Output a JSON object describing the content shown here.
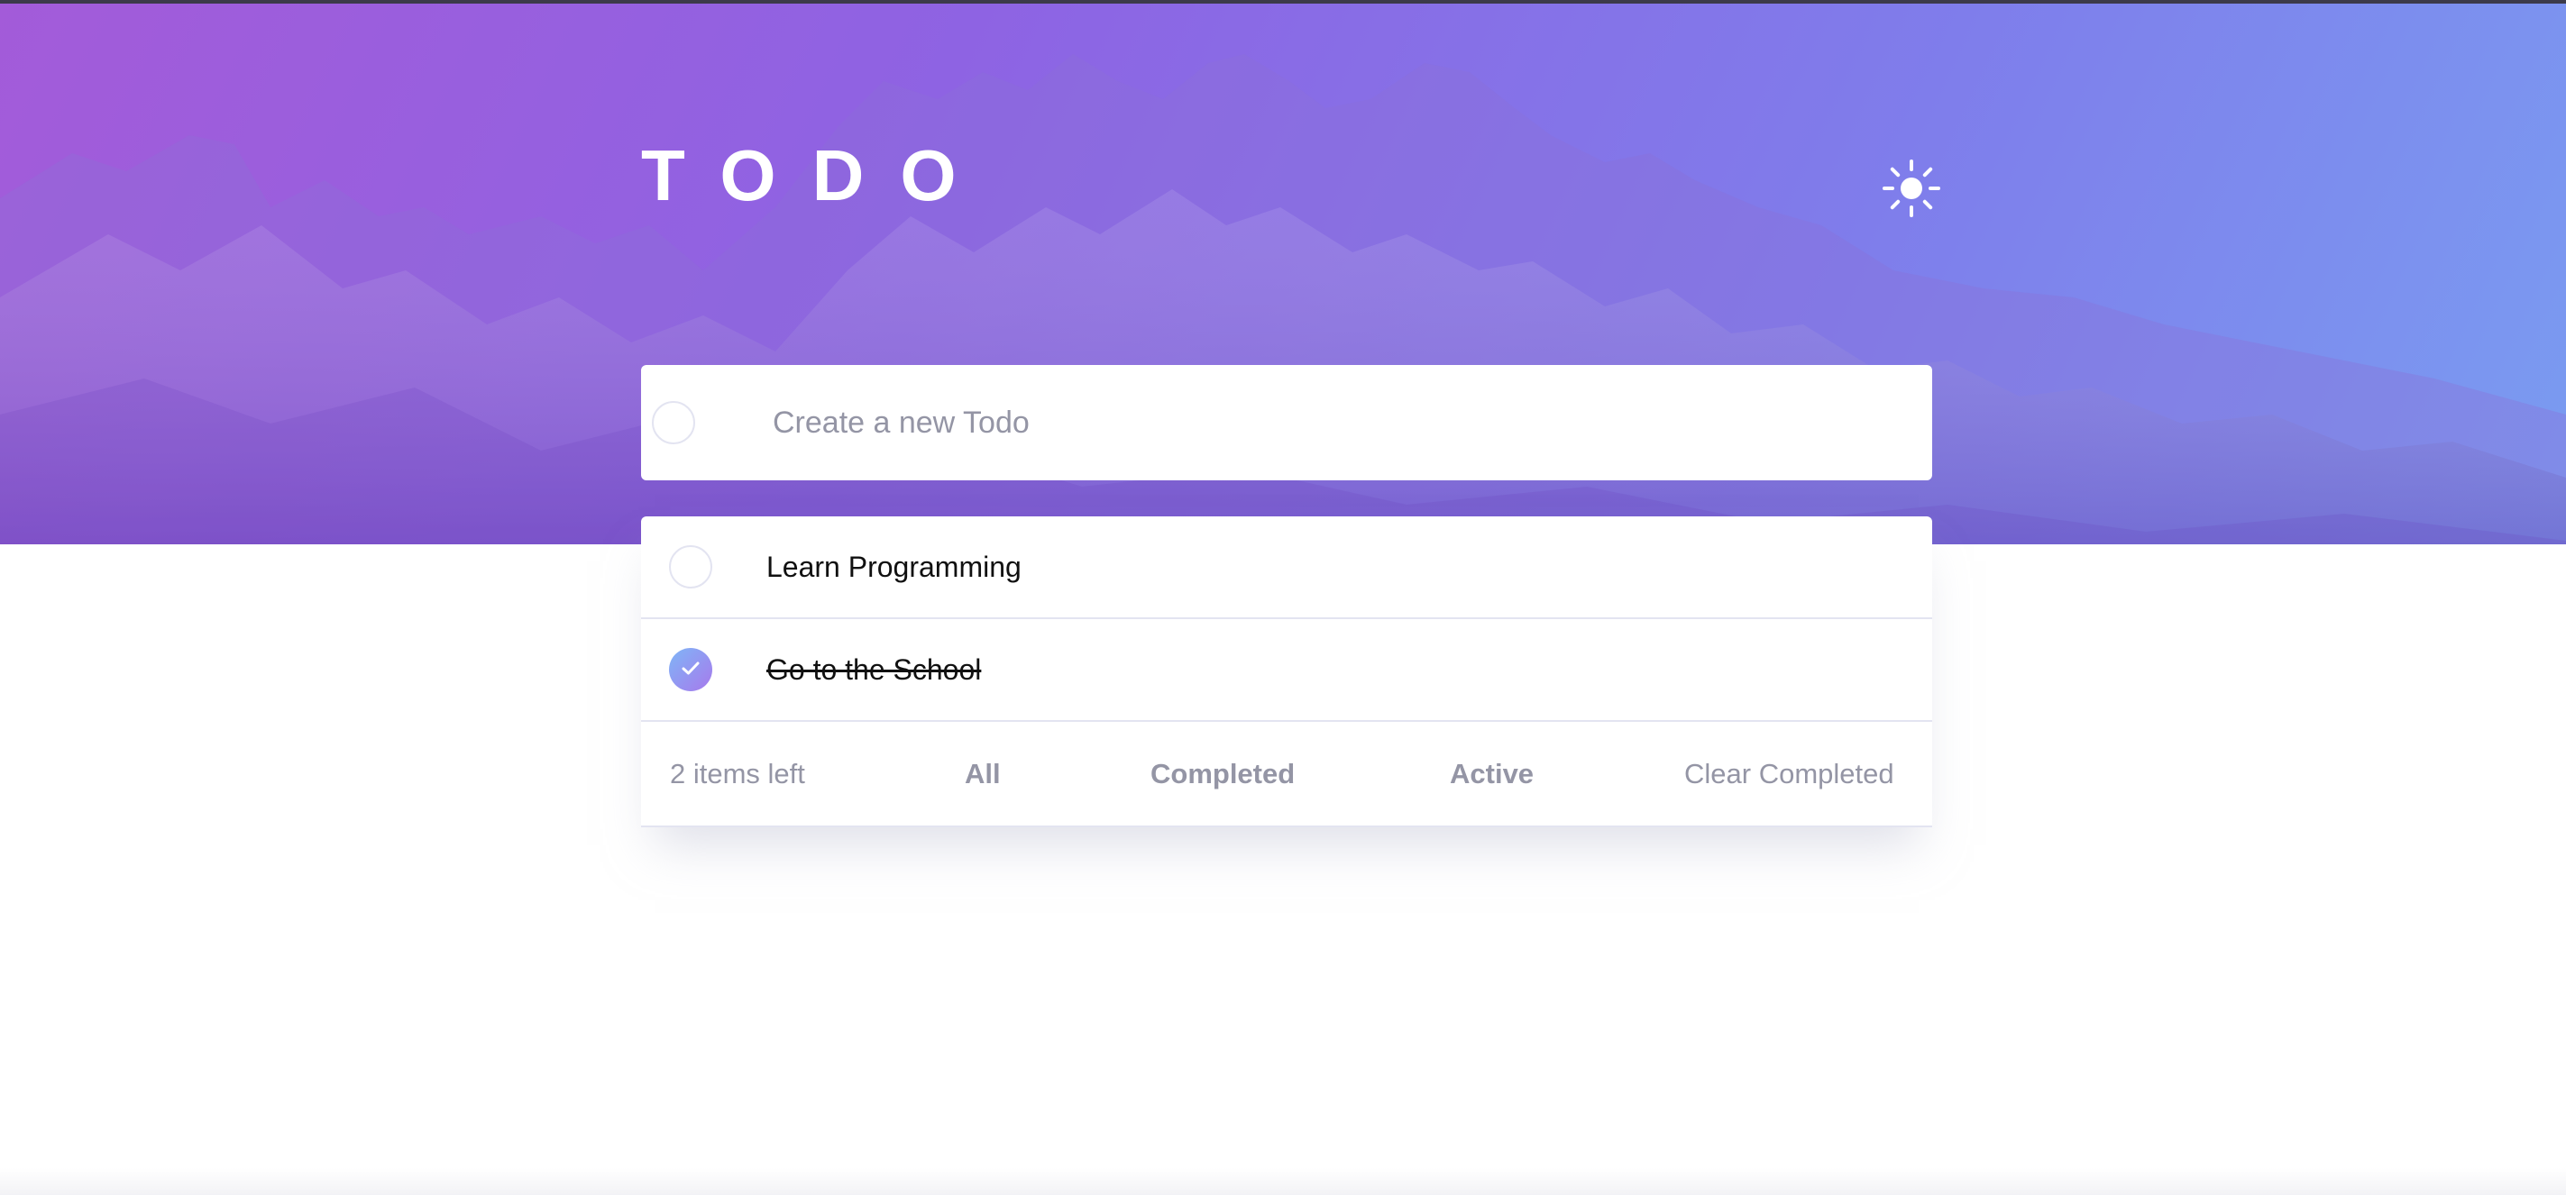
{
  "app": {
    "title": "TODO",
    "theme_toggle_icon": "sun-icon"
  },
  "new_todo": {
    "placeholder": "Create a new Todo",
    "value": ""
  },
  "todos": [
    {
      "text": "Learn Programming",
      "completed": false
    },
    {
      "text": "Go to the School",
      "completed": true
    }
  ],
  "footer": {
    "items_left": "2 items left",
    "filters": {
      "all": "All",
      "completed": "Completed",
      "active": "Active"
    },
    "clear_completed": "Clear Completed"
  },
  "colors": {
    "hero_gradient_start": "#a35bd9",
    "hero_gradient_end": "#7a9cf1",
    "check_gradient_start": "#7fb6f7",
    "check_gradient_end": "#a779ec",
    "muted_text": "#9495a5",
    "border": "#e3e4f1"
  }
}
